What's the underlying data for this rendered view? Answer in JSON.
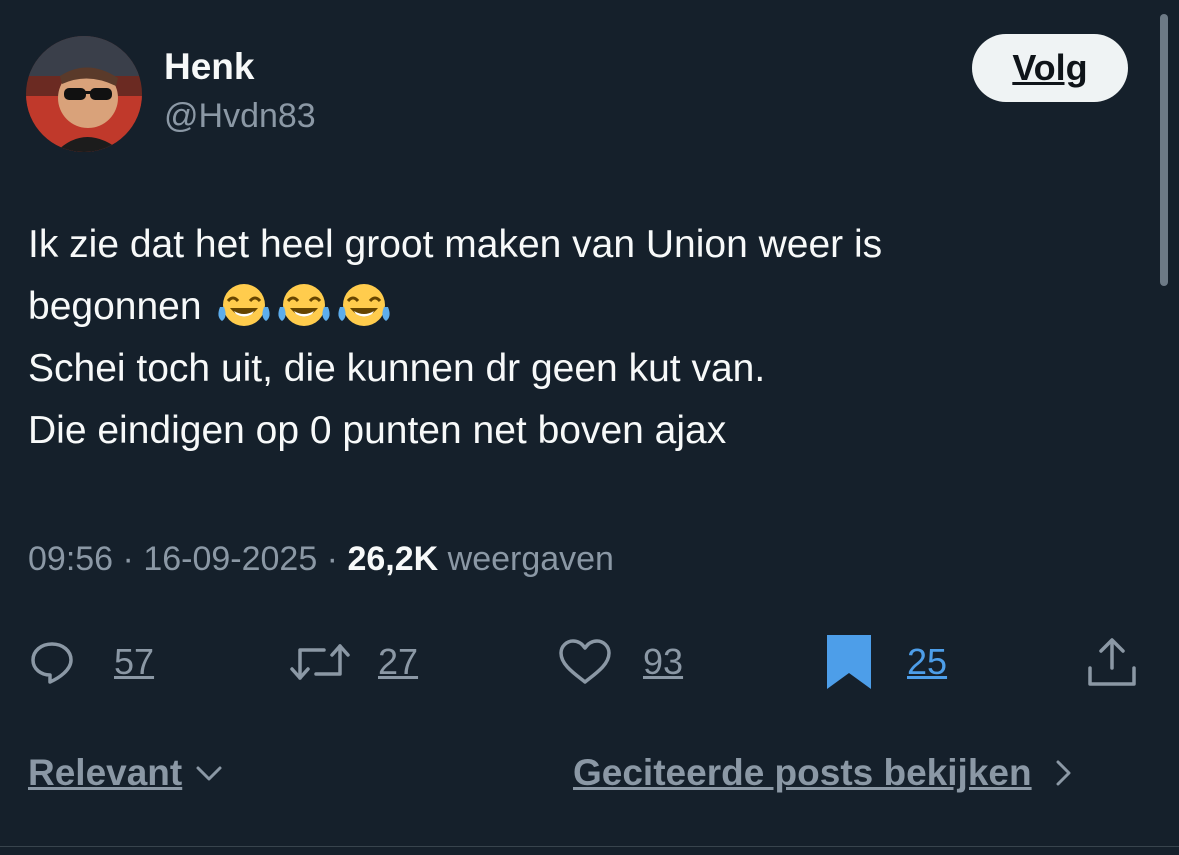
{
  "author": {
    "display_name": "Henk",
    "handle": "@Hvdn83"
  },
  "follow_button": {
    "label": "Volg"
  },
  "tweet": {
    "lines": [
      "Ik zie dat het heel groot maken van Union weer is",
      "begonnen",
      "Schei toch uit, die kunnen dr geen kut van.",
      "Die eindigen op 0 punten net boven ajax"
    ],
    "emoji": [
      "face-with-tears-of-joy",
      "face-with-tears-of-joy",
      "face-with-tears-of-joy"
    ]
  },
  "meta": {
    "time": "09:56",
    "sep1": " · ",
    "date": "16-09-2025",
    "sep2": " · ",
    "views": "26,2K",
    "views_label": " weergaven"
  },
  "actions": {
    "replies": "57",
    "reposts": "27",
    "likes": "93",
    "bookmarks": "25"
  },
  "footer": {
    "sort_label": "Relevant",
    "quotes_label": "Geciteerde posts bekijken"
  },
  "colors": {
    "background": "#15202b",
    "text": "#f7f9f9",
    "muted": "#8b98a5",
    "bookmark_blue": "#4d9ee9"
  }
}
